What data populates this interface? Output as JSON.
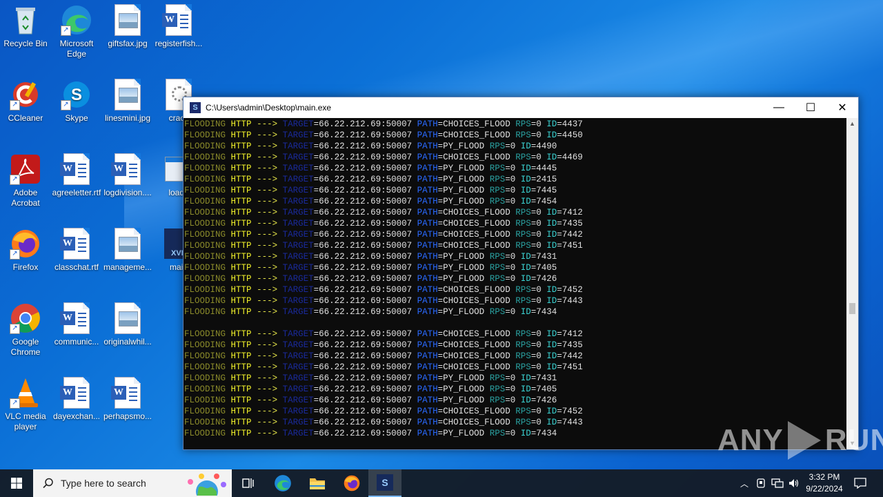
{
  "desktop": {
    "icons": [
      {
        "label": "Recycle Bin"
      },
      {
        "label": "Microsoft Edge"
      },
      {
        "label": "giftsfax.jpg"
      },
      {
        "label": "registerfish..."
      },
      {
        "label": "CCleaner"
      },
      {
        "label": "Skype"
      },
      {
        "label": "linesmini.jpg"
      },
      {
        "label": "crack"
      },
      {
        "label": "Adobe Acrobat"
      },
      {
        "label": "agreeletter.rtf"
      },
      {
        "label": "logdivision...."
      },
      {
        "label": "loade"
      },
      {
        "label": "Firefox"
      },
      {
        "label": "classchat.rtf"
      },
      {
        "label": "manageme..."
      },
      {
        "label": "main"
      },
      {
        "label": "Google Chrome"
      },
      {
        "label": "communic..."
      },
      {
        "label": "originalwhil..."
      },
      {
        "label": "VLC media player"
      },
      {
        "label": "dayexchan..."
      },
      {
        "label": "perhapsmo..."
      }
    ],
    "xvelo_badge": "XVE"
  },
  "console": {
    "title": "C:\\Users\\admin\\Desktop\\main.exe",
    "icon_letter": "S",
    "minimize": "—",
    "maximize": "☐",
    "close": "✕",
    "tokens": {
      "flooding": "FLOODING",
      "http": "HTTP",
      "arrow": "--->",
      "target": "TARGET",
      "target_value": "=66.22.212.69:50007",
      "path": "PATH",
      "rps": "RPS",
      "rps_value": "=0",
      "id": "ID"
    },
    "lines": [
      {
        "path": "=CHOICES_FLOOD",
        "id": "=4437"
      },
      {
        "path": "=CHOICES_FLOOD",
        "id": "=4450"
      },
      {
        "path": "=PY_FLOOD",
        "id": "=4490"
      },
      {
        "path": "=CHOICES_FLOOD",
        "id": "=4469"
      },
      {
        "path": "=PY_FLOOD",
        "id": "=4445"
      },
      {
        "path": "=PY_FLOOD",
        "id": "=2415"
      },
      {
        "path": "=PY_FLOOD",
        "id": "=7445"
      },
      {
        "path": "=PY_FLOOD",
        "id": "=7454"
      },
      {
        "path": "=CHOICES_FLOOD",
        "id": "=7412"
      },
      {
        "path": "=CHOICES_FLOOD",
        "id": "=7435"
      },
      {
        "path": "=CHOICES_FLOOD",
        "id": "=7442"
      },
      {
        "path": "=CHOICES_FLOOD",
        "id": "=7451"
      },
      {
        "path": "=PY_FLOOD",
        "id": "=7431"
      },
      {
        "path": "=PY_FLOOD",
        "id": "=7405"
      },
      {
        "path": "=PY_FLOOD",
        "id": "=7426"
      },
      {
        "path": "=CHOICES_FLOOD",
        "id": "=7452"
      },
      {
        "path": "=CHOICES_FLOOD",
        "id": "=7443"
      },
      {
        "path": "=PY_FLOOD",
        "id": "=7434"
      },
      {
        "blank": true
      },
      {
        "path": "=CHOICES_FLOOD",
        "id": "=7412"
      },
      {
        "path": "=CHOICES_FLOOD",
        "id": "=7435"
      },
      {
        "path": "=CHOICES_FLOOD",
        "id": "=7442"
      },
      {
        "path": "=CHOICES_FLOOD",
        "id": "=7451"
      },
      {
        "path": "=PY_FLOOD",
        "id": "=7431"
      },
      {
        "path": "=PY_FLOOD",
        "id": "=7405"
      },
      {
        "path": "=PY_FLOOD",
        "id": "=7426"
      },
      {
        "path": "=CHOICES_FLOOD",
        "id": "=7452"
      },
      {
        "path": "=CHOICES_FLOOD",
        "id": "=7443"
      },
      {
        "path": "=PY_FLOOD",
        "id": "=7434"
      }
    ]
  },
  "watermark": {
    "left": "ANY",
    "right": "RUN"
  },
  "taskbar": {
    "search_placeholder": "Type here to search",
    "time": "3:32 PM",
    "date": "9/22/2024"
  }
}
